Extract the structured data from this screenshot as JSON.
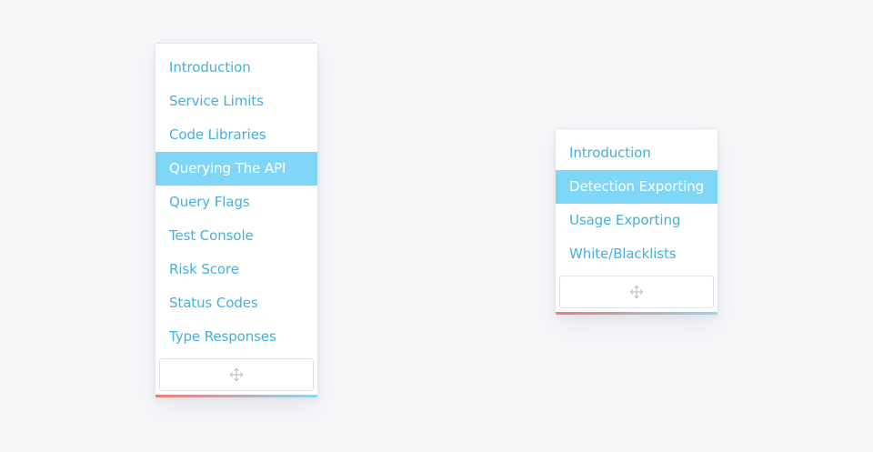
{
  "colors": {
    "page_background": "#f7f8fa",
    "link_text": "#45b0de",
    "active_background": "#7fd6f7",
    "active_text": "#ffffff",
    "accent_start": "#ef7b72",
    "accent_end": "#8fd6f5",
    "move_icon": "#b9bec5"
  },
  "left_menu": {
    "items": [
      {
        "label": "Introduction",
        "active": false
      },
      {
        "label": "Service Limits",
        "active": false
      },
      {
        "label": "Code Libraries",
        "active": false
      },
      {
        "label": "Querying The API",
        "active": true
      },
      {
        "label": "Query Flags",
        "active": false
      },
      {
        "label": "Test Console",
        "active": false
      },
      {
        "label": "Risk Score",
        "active": false
      },
      {
        "label": "Status Codes",
        "active": false
      },
      {
        "label": "Type Responses",
        "active": false
      }
    ],
    "handle_icon": "move-arrows-icon"
  },
  "right_menu": {
    "items": [
      {
        "label": "Introduction",
        "active": false
      },
      {
        "label": "Detection Exporting",
        "active": true
      },
      {
        "label": "Usage Exporting",
        "active": false
      },
      {
        "label": "White/Blacklists",
        "active": false
      }
    ],
    "handle_icon": "move-arrows-icon"
  }
}
